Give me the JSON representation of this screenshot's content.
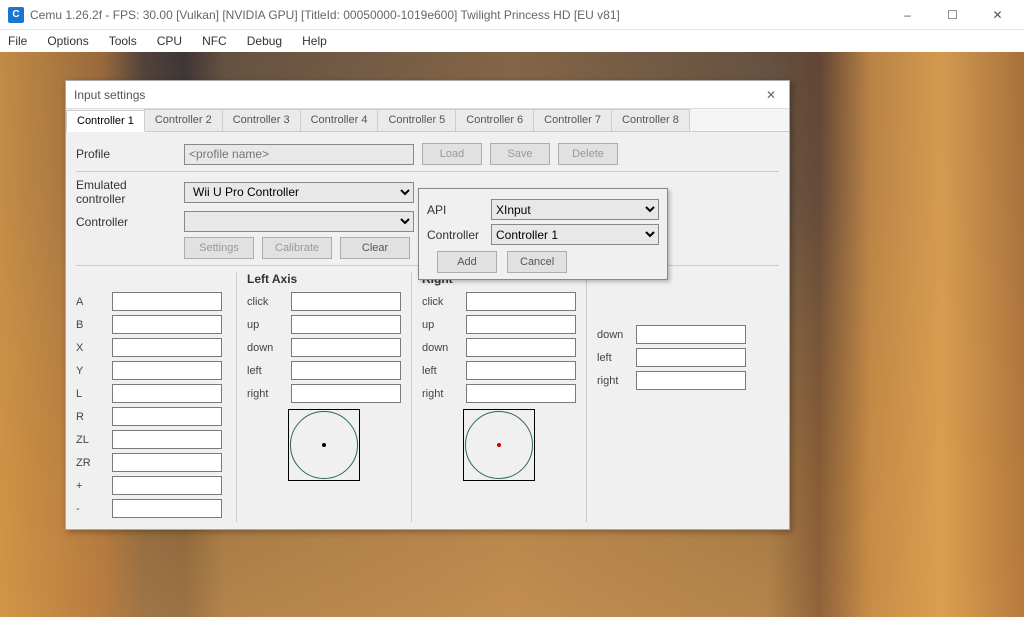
{
  "window": {
    "icon_letter": "C",
    "title": "Cemu 1.26.2f - FPS: 30.00 [Vulkan] [NVIDIA GPU] [TitleId: 00050000-1019e600] Twilight Princess HD [EU v81]"
  },
  "window_controls": {
    "min": "–",
    "max": "☐",
    "close": "✕"
  },
  "menu": [
    "File",
    "Options",
    "Tools",
    "CPU",
    "NFC",
    "Debug",
    "Help"
  ],
  "dialog": {
    "title": "Input settings",
    "close": "✕",
    "tabs": [
      "Controller 1",
      "Controller 2",
      "Controller 3",
      "Controller 4",
      "Controller 5",
      "Controller 6",
      "Controller 7",
      "Controller 8"
    ],
    "profile_label": "Profile",
    "profile_placeholder": "<profile name>",
    "btn_load": "Load",
    "btn_save": "Save",
    "btn_delete": "Delete",
    "emulated_label": "Emulated controller",
    "emulated_value": "Wii U Pro Controller",
    "controller_label": "Controller",
    "controller_value": "",
    "btn_add_small": "+",
    "btn_remove_small": "−",
    "btn_settings": "Settings",
    "btn_calibrate": "Calibrate",
    "btn_clear": "Clear",
    "buttons_col": [
      "A",
      "B",
      "X",
      "Y",
      "L",
      "R",
      "ZL",
      "ZR",
      "+",
      "-"
    ],
    "left_axis_label": "Left Axis",
    "right_axis_label": "Right",
    "axis_rows": [
      "click",
      "up",
      "down",
      "left",
      "right"
    ],
    "extra_rows": [
      "down",
      "left",
      "right"
    ]
  },
  "popup": {
    "api_label": "API",
    "api_value": "XInput",
    "controller_label": "Controller",
    "controller_value": "Controller 1",
    "btn_add": "Add",
    "btn_cancel": "Cancel"
  },
  "colors": {
    "axis_left_dot": "#000000",
    "axis_right_dot": "#cc0000"
  }
}
